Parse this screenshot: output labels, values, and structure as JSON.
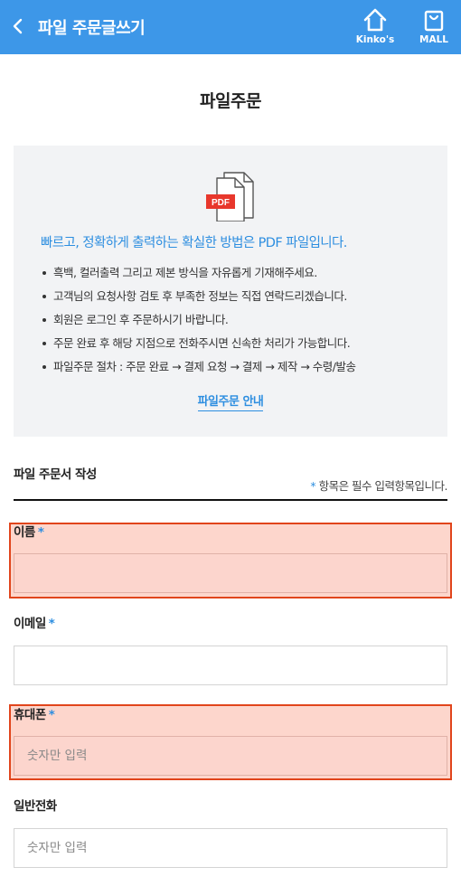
{
  "header": {
    "title": "파일 주문글쓰기",
    "home_label": "Kinko's",
    "mall_label": "MALL"
  },
  "page": {
    "title": "파일주문"
  },
  "info": {
    "pdf_badge": "PDF",
    "lead": "빠르고, 정확하게 출력하는 확실한 방법은 PDF 파일입니다.",
    "bullets": [
      "흑백, 컬러출력 그리고 제본 방식을 자유롭게 기재해주세요.",
      "고객님의 요청사항 검토 후 부족한 정보는 직접 연락드리겠습니다.",
      "회원은 로그인 후 주문하시기 바랍니다.",
      "주문 완료 후 해당 지점으로 전화주시면 신속한 처리가 가능합니다.",
      "파일주문 절차 : 주문 완료 → 결제 요청 → 결제 → 제작 → 수령/발송"
    ],
    "guide_link": "파일주문 안내"
  },
  "form": {
    "section_title": "파일 주문서 작성",
    "required_star": "*",
    "required_note": "항목은 필수 입력항목입니다.",
    "fields": {
      "name": {
        "label": "이름",
        "required_mark": "*",
        "value": "",
        "placeholder": ""
      },
      "email": {
        "label": "이메일",
        "required_mark": "*",
        "value": "",
        "placeholder": ""
      },
      "mobile": {
        "label": "휴대폰",
        "required_mark": "*",
        "value": "",
        "placeholder": "숫자만 입력"
      },
      "phone": {
        "label": "일반전화",
        "value": "",
        "placeholder": "숫자만 입력"
      }
    }
  },
  "colors": {
    "header_bg": "#3d97e8",
    "accent": "#2d8ee0",
    "highlight_border": "#e1451c",
    "highlight_fill": "#fdd6cc",
    "pdf_red": "#e8372c"
  },
  "icons": {
    "back": "chevron-left-icon",
    "home": "home-icon",
    "mall": "shopping-bag-icon",
    "file": "pdf-file-icon"
  }
}
